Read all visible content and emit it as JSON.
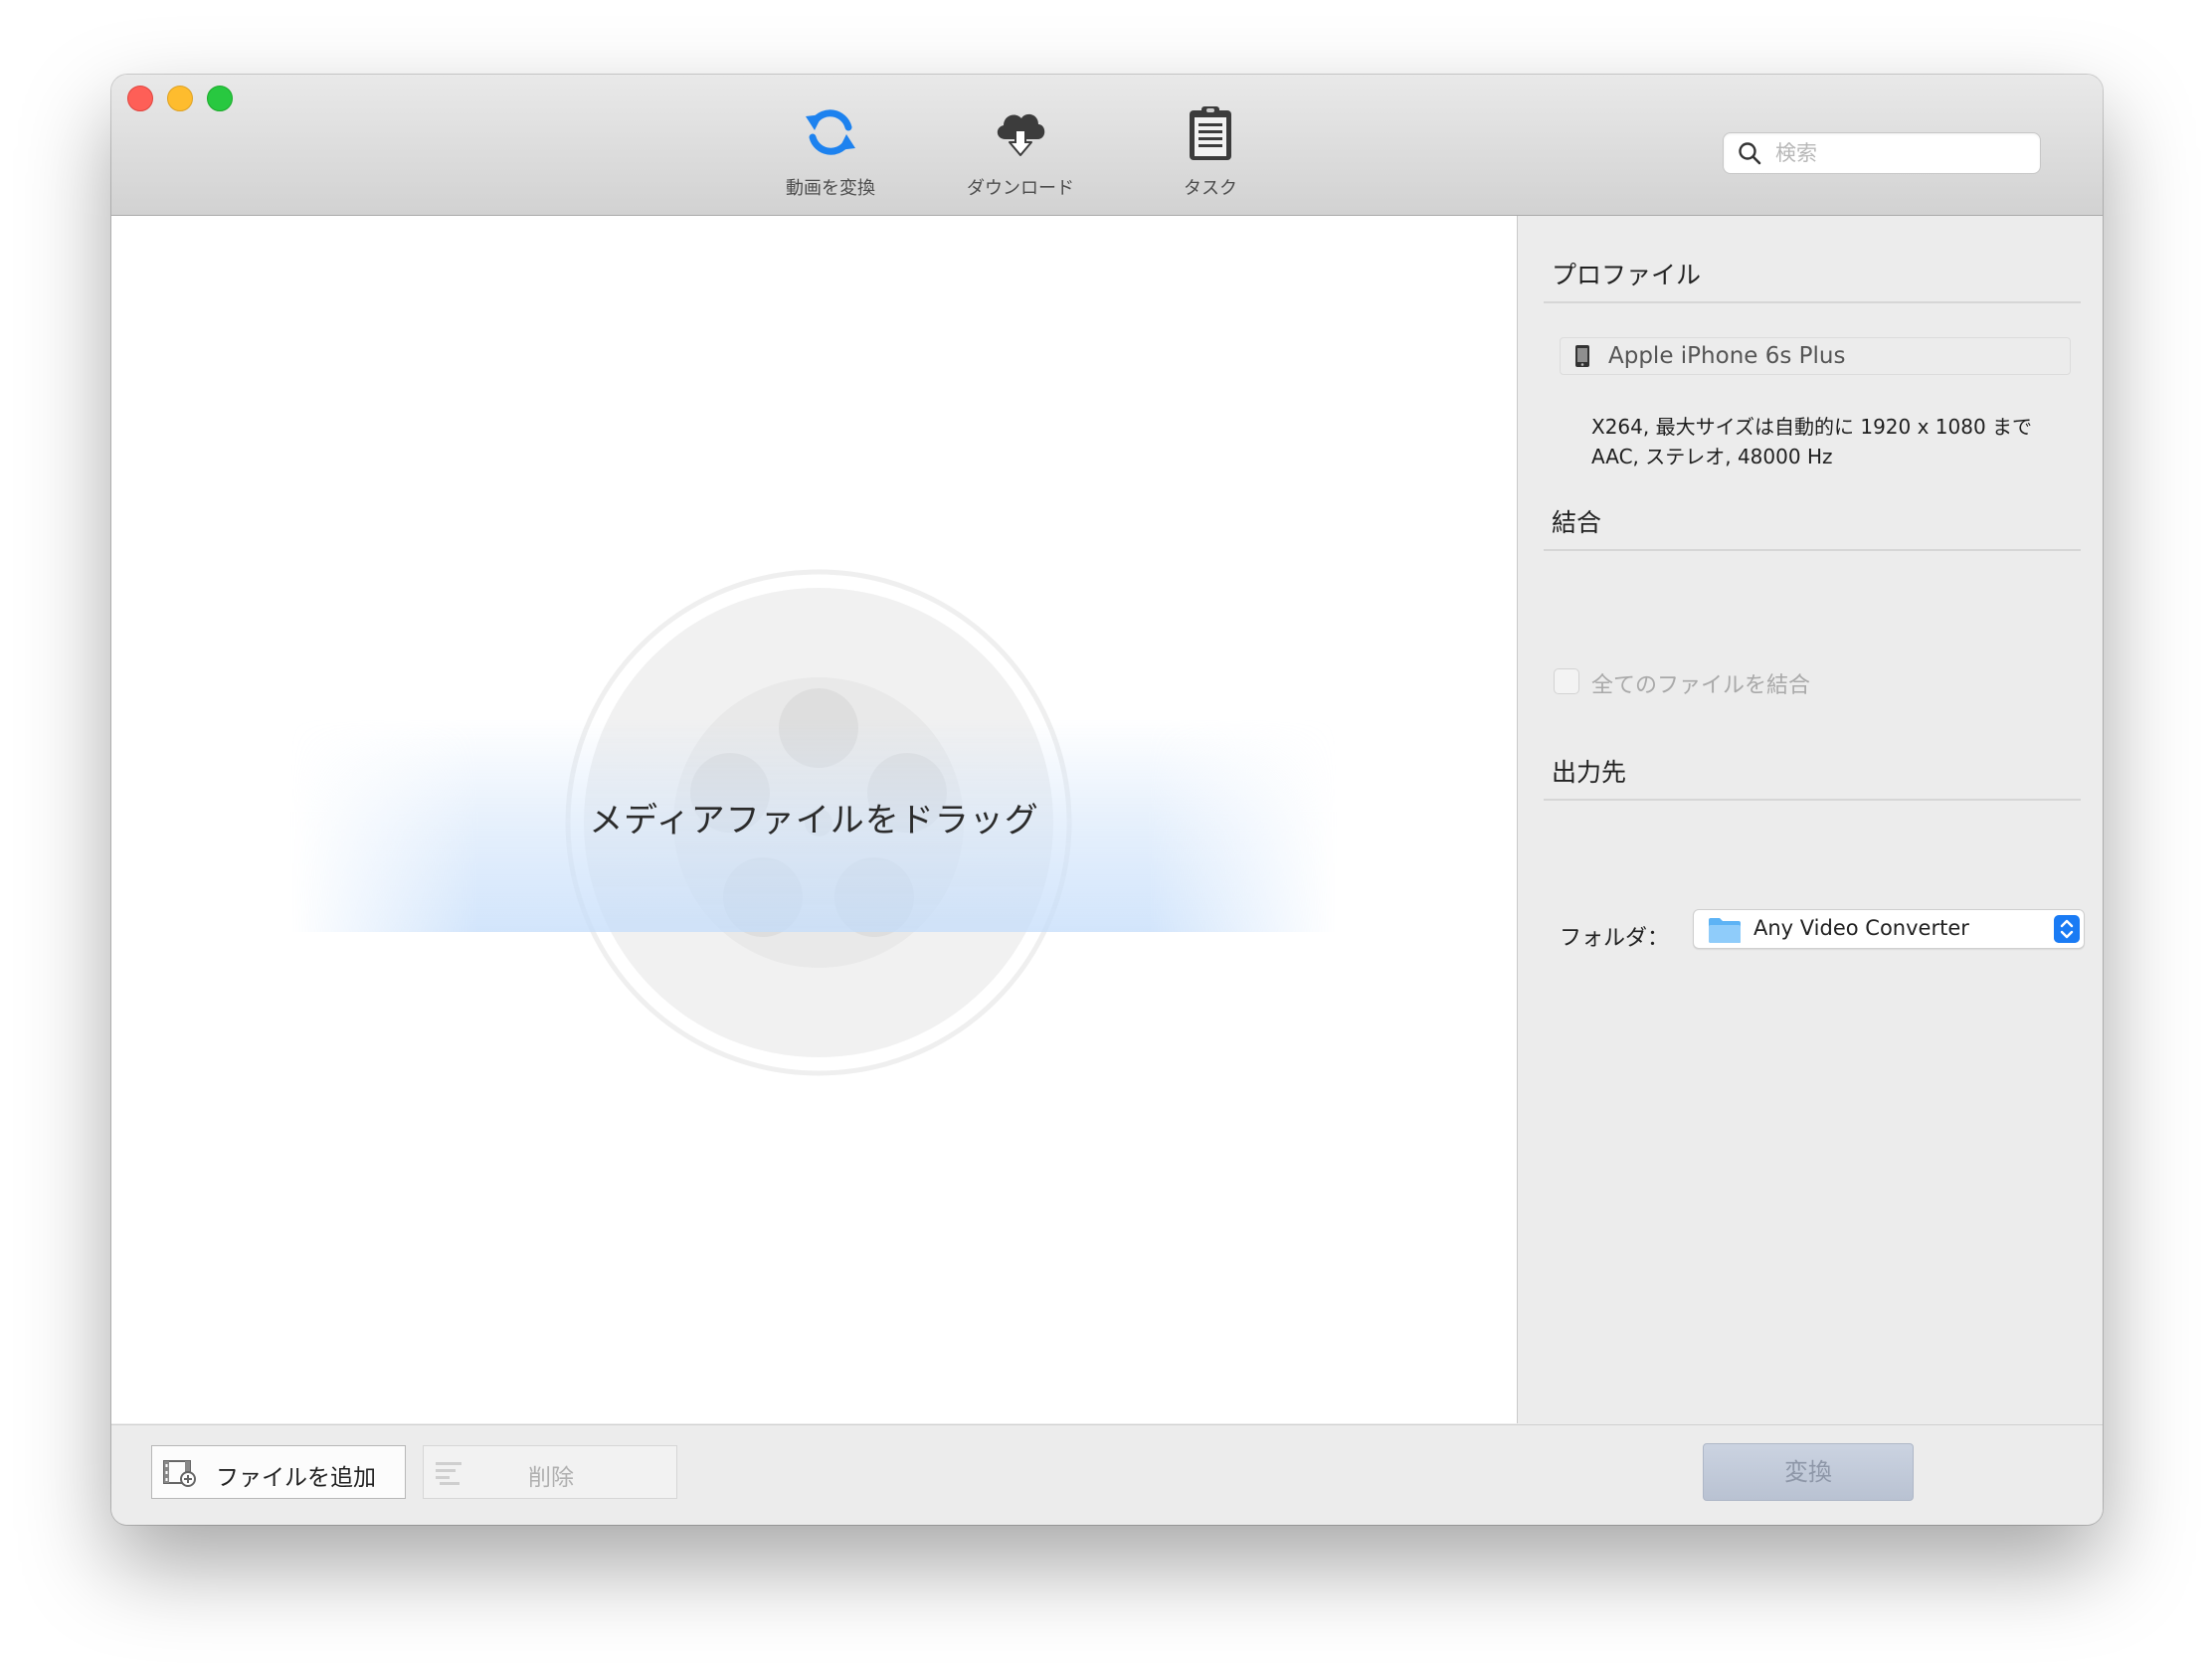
{
  "toolbar": {
    "convert_label": "動画を変換",
    "download_label": "ダウンロード",
    "task_label": "タスク",
    "search_placeholder": "検索"
  },
  "main": {
    "drop_text": "メディアファイルをドラッグ"
  },
  "panel": {
    "profile_title": "プロファイル",
    "profile_name": "Apple iPhone 6s Plus",
    "profile_video": "X264, 最大サイズは自動的に 1920 x 1080 まで",
    "profile_audio": "AAC, ステレオ, 48000 Hz",
    "merge_title": "結合",
    "merge_checkbox_label": "全てのファイルを結合",
    "merge_checked": false,
    "output_title": "出力先",
    "folder_label": "フォルダ：",
    "folder_value": "Any Video Converter"
  },
  "bottom": {
    "add_file_label": "ファイルを追加",
    "delete_label": "削除",
    "convert_label": "変換"
  },
  "colors": {
    "accent": "#1474f2",
    "close": "#fe5f57",
    "minimize": "#febc2e",
    "zoom": "#28c840"
  },
  "icons": {
    "convert": "refresh-icon",
    "download": "cloud-download-icon",
    "task": "clipboard-icon",
    "search": "search-icon",
    "phone": "phone-icon",
    "folder": "folder-icon",
    "add_file": "film-add-icon",
    "delete": "list-remove-icon"
  }
}
